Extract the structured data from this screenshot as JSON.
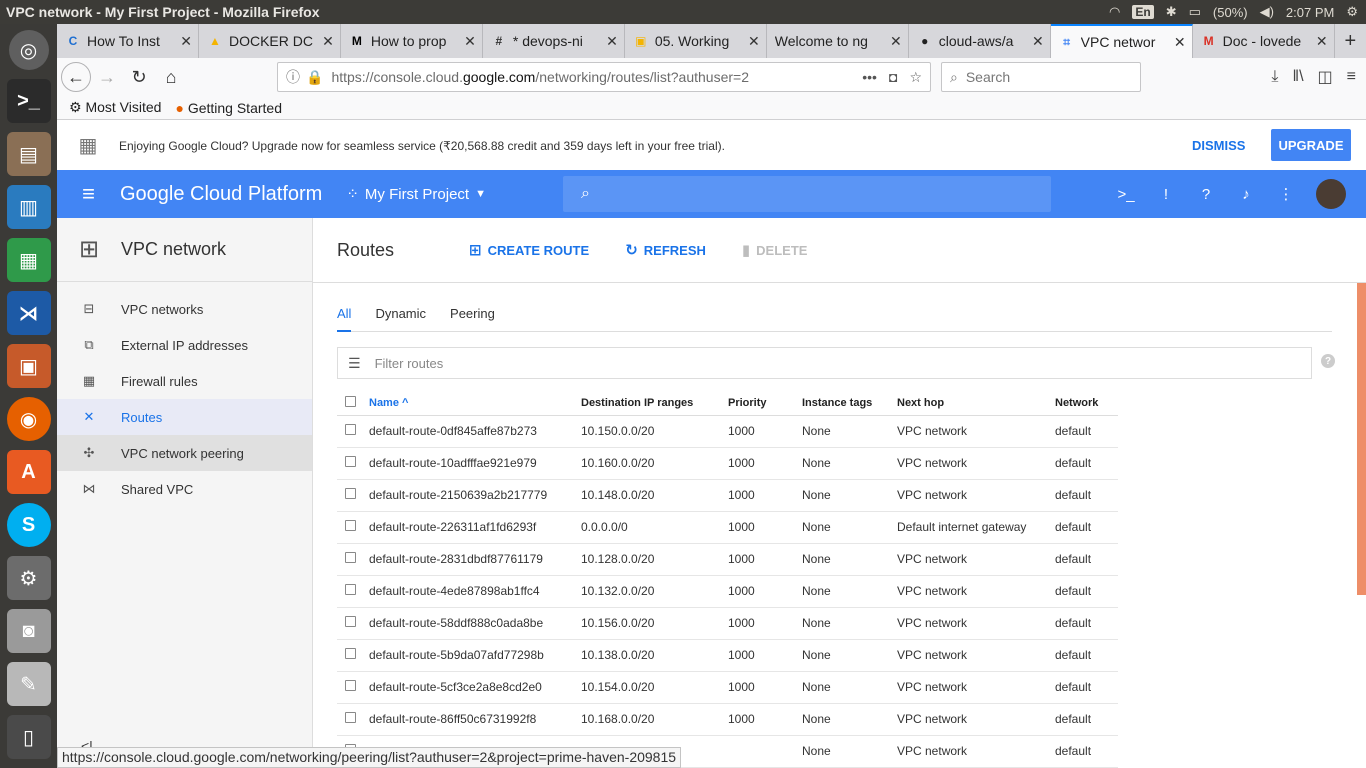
{
  "os": {
    "window_title": "VPC network - My First Project - Mozilla Firefox",
    "keyboard": "En",
    "battery": "(50%)",
    "clock": "2:07 PM"
  },
  "tabs": [
    {
      "title": "How To Inst",
      "fav": "C",
      "favcolor": "#1f6fd1"
    },
    {
      "title": "DOCKER DC",
      "fav": "▲",
      "favcolor": "#f4b400"
    },
    {
      "title": "How to prop",
      "fav": "M",
      "favcolor": "#000000"
    },
    {
      "title": "* devops-ni",
      "fav": "#",
      "favcolor": "#333333"
    },
    {
      "title": "05. Working",
      "fav": "▣",
      "favcolor": "#f4b400"
    },
    {
      "title": "Welcome to ng",
      "fav": "",
      "favcolor": "#999999"
    },
    {
      "title": "cloud-aws/a",
      "fav": "●",
      "favcolor": "#222222"
    },
    {
      "title": "VPC networ",
      "fav": "⌗",
      "favcolor": "#4285f4"
    },
    {
      "title": "Doc - lovede",
      "fav": "M",
      "favcolor": "#d93025"
    }
  ],
  "url": {
    "prefix": "https://console.cloud.",
    "host": "google.com",
    "path": "/networking/routes/list?authuser=2"
  },
  "search_placeholder": "Search",
  "bookmarks": {
    "most_visited": "Most Visited",
    "getting_started": "Getting Started"
  },
  "banner": {
    "text": "Enjoying Google Cloud? Upgrade now for seamless service (₹20,568.88 credit and 359 days left in your free trial).",
    "dismiss": "DISMISS",
    "upgrade": "UPGRADE"
  },
  "gcp": {
    "brand": "Google Cloud Platform",
    "project": "My First Project"
  },
  "sidebar": {
    "title": "VPC network",
    "items": [
      {
        "label": "VPC networks",
        "icon": "⊟"
      },
      {
        "label": "External IP addresses",
        "icon": "⧉"
      },
      {
        "label": "Firewall rules",
        "icon": "▦"
      },
      {
        "label": "Routes",
        "icon": "✕"
      },
      {
        "label": "VPC network peering",
        "icon": "✣"
      },
      {
        "label": "Shared VPC",
        "icon": "⋈"
      }
    ]
  },
  "main": {
    "title": "Routes",
    "create": "CREATE ROUTE",
    "refresh": "REFRESH",
    "delete": "DELETE",
    "subtabs": [
      "All",
      "Dynamic",
      "Peering"
    ],
    "filter_placeholder": "Filter routes"
  },
  "table": {
    "headers": [
      "Name",
      "Destination IP ranges",
      "Priority",
      "Instance tags",
      "Next hop",
      "Network"
    ],
    "rows": [
      [
        "default-route-0df845affe87b273",
        "10.150.0.0/20",
        "1000",
        "None",
        "VPC network",
        "default"
      ],
      [
        "default-route-10adfffae921e979",
        "10.160.0.0/20",
        "1000",
        "None",
        "VPC network",
        "default"
      ],
      [
        "default-route-2150639a2b217779",
        "10.148.0.0/20",
        "1000",
        "None",
        "VPC network",
        "default"
      ],
      [
        "default-route-226311af1fd6293f",
        "0.0.0.0/0",
        "1000",
        "None",
        "Default internet gateway",
        "default"
      ],
      [
        "default-route-2831dbdf87761179",
        "10.128.0.0/20",
        "1000",
        "None",
        "VPC network",
        "default"
      ],
      [
        "default-route-4ede87898ab1ffc4",
        "10.132.0.0/20",
        "1000",
        "None",
        "VPC network",
        "default"
      ],
      [
        "default-route-58ddf888c0ada8be",
        "10.156.0.0/20",
        "1000",
        "None",
        "VPC network",
        "default"
      ],
      [
        "default-route-5b9da07afd77298b",
        "10.138.0.0/20",
        "1000",
        "None",
        "VPC network",
        "default"
      ],
      [
        "default-route-5cf3ce2a8e8cd2e0",
        "10.154.0.0/20",
        "1000",
        "None",
        "VPC network",
        "default"
      ],
      [
        "default-route-86ff50c6731992f8",
        "10.168.0.0/20",
        "1000",
        "None",
        "VPC network",
        "default"
      ],
      [
        "",
        "",
        "",
        "None",
        "VPC network",
        "default"
      ]
    ]
  },
  "status_url": "https://console.cloud.google.com/networking/peering/list?authuser=2&project=prime-haven-209815"
}
